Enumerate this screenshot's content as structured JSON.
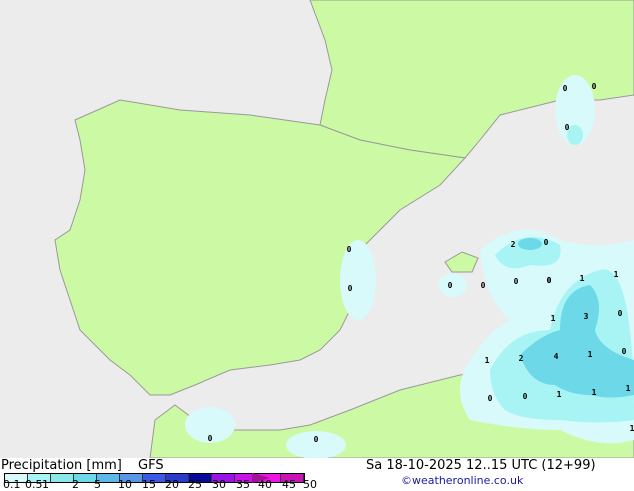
{
  "title": "Precipitation [mm]",
  "model": "GFS",
  "datetime": "Sa 18-10-2025 12..15 UTC (12+99)",
  "credit": "©weatheronline.co.uk",
  "legend": {
    "ticks": [
      "0.1",
      "0.5",
      "1",
      "2",
      "5",
      "10",
      "15",
      "20",
      "25",
      "30",
      "35",
      "40",
      "45",
      "50"
    ],
    "colors": [
      "#d8fafa",
      "#a8f4f4",
      "#8ae8e8",
      "#6cd8e8",
      "#5ab8ea",
      "#5a96e6",
      "#3c5ae6",
      "#2a3cc8",
      "#0a0a9a",
      "#9a14e6",
      "#c814e6",
      "#f014e6",
      "#c814b4"
    ],
    "arrow_color": "#a01496"
  },
  "colors": {
    "sea": "#ececec",
    "land": "#ccfaa4",
    "border": "#999999"
  },
  "map_labels": [
    "0",
    "0",
    "0",
    "0",
    "0",
    "0",
    "0",
    "2",
    "0",
    "0",
    "0",
    "0",
    "1",
    "1",
    "1",
    "3",
    "0",
    "1",
    "2",
    "4",
    "1",
    "0",
    "0",
    "0",
    "1",
    "1",
    "1",
    "1",
    "0",
    "0"
  ]
}
